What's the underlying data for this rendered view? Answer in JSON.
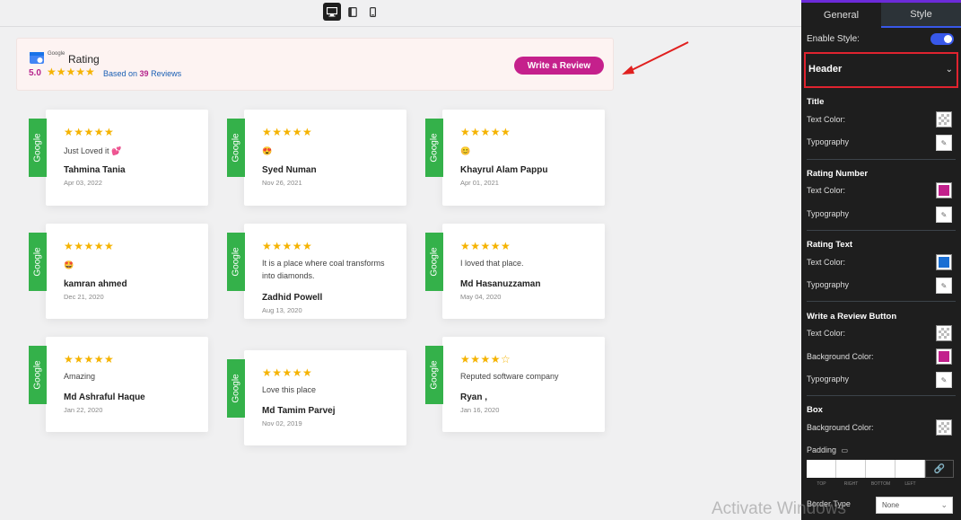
{
  "header": {
    "logo_text": "Google",
    "title": "Rating",
    "rating_number": "5.0",
    "stars": "★★★★★",
    "based_on_prefix": "Based on",
    "review_count": "39",
    "based_on_suffix": "Reviews",
    "write_button": "Write a Review"
  },
  "reviews": [
    {
      "tag": "Google",
      "stars": "★★★★★",
      "text": "Just Loved it 💕",
      "name": "Tahmina Tania",
      "date": "Apr 03, 2022"
    },
    {
      "tag": "Google",
      "stars": "★★★★★",
      "text": "😍",
      "name": "Syed Numan",
      "date": "Nov 26, 2021"
    },
    {
      "tag": "Google",
      "stars": "★★★★★",
      "text": "😊",
      "name": "Khayrul Alam Pappu",
      "date": "Apr 01, 2021"
    },
    {
      "tag": "Google",
      "stars": "★★★★★",
      "text": "🤩",
      "name": "kamran ahmed",
      "date": "Dec 21, 2020"
    },
    {
      "tag": "Google",
      "stars": "★★★★★",
      "text": "It is a place where coal transforms into diamonds.",
      "name": "Zadhid Powell",
      "date": "Aug 13, 2020"
    },
    {
      "tag": "Google",
      "stars": "★★★★★",
      "text": "I loved that place.",
      "name": "Md Hasanuzzaman",
      "date": "May 04, 2020"
    },
    {
      "tag": "Google",
      "stars": "★★★★★",
      "text": "Amazing",
      "name": "Md Ashraful Haque",
      "date": "Jan 22, 2020"
    },
    {
      "tag": "Google",
      "stars": "★★★★★",
      "text": "Love this place",
      "name": "Md Tamim Parvej",
      "date": "Nov 02, 2019"
    },
    {
      "tag": "Google",
      "stars": "★★★★☆",
      "text": "Reputed software company",
      "name": "Ryan ,",
      "date": "Jan 16, 2020"
    }
  ],
  "panel": {
    "tabs": [
      "General",
      "Style"
    ],
    "enable_style": "Enable Style:",
    "section": "Header",
    "title_group": "Title",
    "rating_number_group": "Rating Number",
    "rating_text_group": "Rating Text",
    "write_button_group": "Write a Review Button",
    "box_group": "Box",
    "text_color": "Text Color:",
    "typography": "Typography",
    "background_color": "Background Color:",
    "padding": "Padding",
    "pad_labels": [
      "TOP",
      "RIGHT",
      "BOTTOM",
      "LEFT"
    ],
    "border_type": "Border Type",
    "border_value": "None"
  },
  "colors": {
    "rating_number": "#c2208c",
    "rating_text": "#1a6fd4",
    "button_bg": "#c2208c",
    "google_tag": "#34b14a",
    "star": "#f5b301"
  },
  "watermark": "Activate Windows"
}
